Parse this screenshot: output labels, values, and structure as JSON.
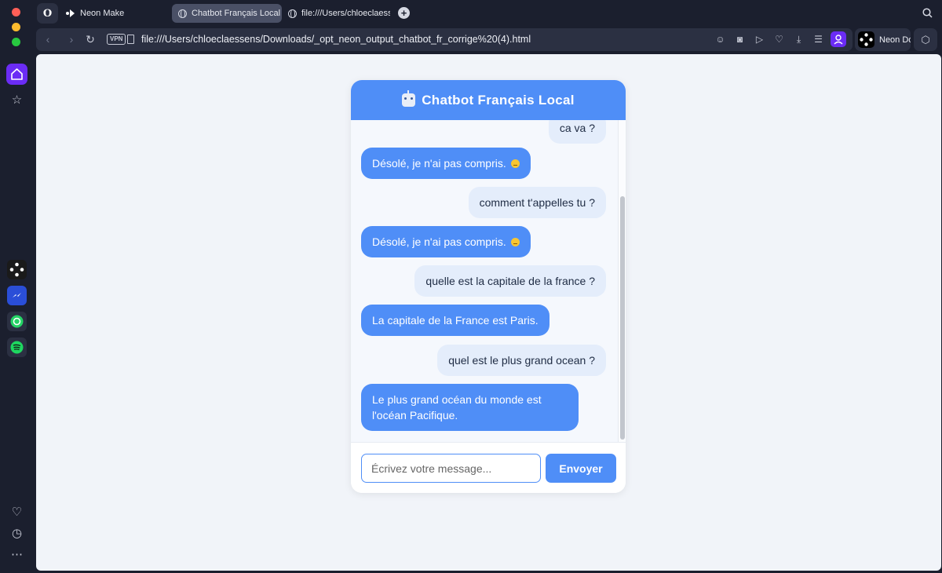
{
  "colors": {
    "accent": "#4f8ef7",
    "opera_purple": "#6b2cf5",
    "traffic_red": "#ff5f57",
    "traffic_yellow": "#febc2e",
    "traffic_green": "#28c840"
  },
  "tabs": [
    {
      "label": "Neon Make",
      "icon": "neon-make-icon",
      "active": false
    },
    {
      "label": "Chatbot Français Local",
      "icon": "globe-icon",
      "active": true
    },
    {
      "label": "file:///Users/chloeclaessens",
      "icon": "globe-icon",
      "active": false
    }
  ],
  "address_bar": {
    "vpn_label": "VPN",
    "url": "file:///Users/chloeclaessens/Downloads/_opt_neon_output_chatbot_fr_corrige%20(4).html"
  },
  "neon_do": {
    "label": "Neon Do"
  },
  "chat": {
    "title": "Chatbot Français Local",
    "messages": [
      {
        "role": "user",
        "text": "ca va ?"
      },
      {
        "role": "bot",
        "text": "Désolé, je n'ai pas compris.",
        "emoji": "confused-face"
      },
      {
        "role": "user",
        "text": "comment t'appelles tu ?"
      },
      {
        "role": "bot",
        "text": "Désolé, je n'ai pas compris.",
        "emoji": "confused-face"
      },
      {
        "role": "user",
        "text": "quelle est la capitale de la france ?"
      },
      {
        "role": "bot",
        "text": "La capitale de la France est Paris."
      },
      {
        "role": "user",
        "text": "quel est le plus grand ocean ?"
      },
      {
        "role": "bot",
        "text": "Le plus grand océan du monde est l'océan Pacifique."
      }
    ],
    "input_placeholder": "Écrivez votre message...",
    "input_value": "",
    "send_label": "Envoyer"
  }
}
